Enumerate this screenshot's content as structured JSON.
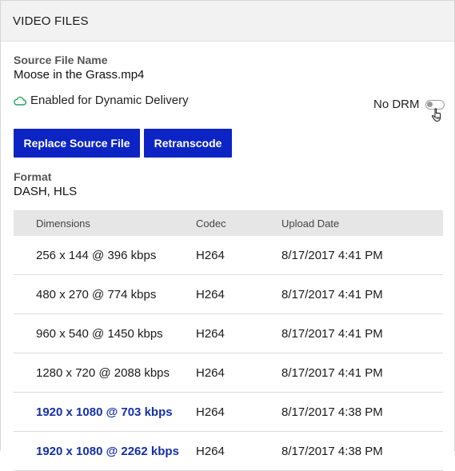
{
  "header": {
    "title": "VIDEO FILES"
  },
  "source": {
    "label": "Source File Name",
    "value": "Moose in the Grass.mp4"
  },
  "status": {
    "text": "Enabled for Dynamic Delivery",
    "icon": "cloud-icon",
    "icon_color": "#1fa35a"
  },
  "drm": {
    "label": "No DRM",
    "enabled": false
  },
  "buttons": {
    "replace": "Replace Source File",
    "retranscode": "Retranscode",
    "color": "#0c24c4"
  },
  "format": {
    "label": "Format",
    "value": "DASH, HLS"
  },
  "table": {
    "headers": [
      "Dimensions",
      "Codec",
      "Upload Date"
    ],
    "rows": [
      {
        "dimensions": "256 x 144 @ 396 kbps",
        "codec": "H264",
        "date": "8/17/2017 4:41 PM",
        "link": false
      },
      {
        "dimensions": "480 x 270 @ 774 kbps",
        "codec": "H264",
        "date": "8/17/2017 4:41 PM",
        "link": false
      },
      {
        "dimensions": "960 x 540 @ 1450 kbps",
        "codec": "H264",
        "date": "8/17/2017 4:41 PM",
        "link": false
      },
      {
        "dimensions": "1280 x 720 @ 2088 kbps",
        "codec": "H264",
        "date": "8/17/2017 4:41 PM",
        "link": false
      },
      {
        "dimensions": "1920 x 1080 @ 703 kbps",
        "codec": "H264",
        "date": "8/17/2017 4:38 PM",
        "link": true
      },
      {
        "dimensions": "1920 x 1080 @ 2262 kbps",
        "codec": "H264",
        "date": "8/17/2017 4:38 PM",
        "link": true
      }
    ]
  }
}
